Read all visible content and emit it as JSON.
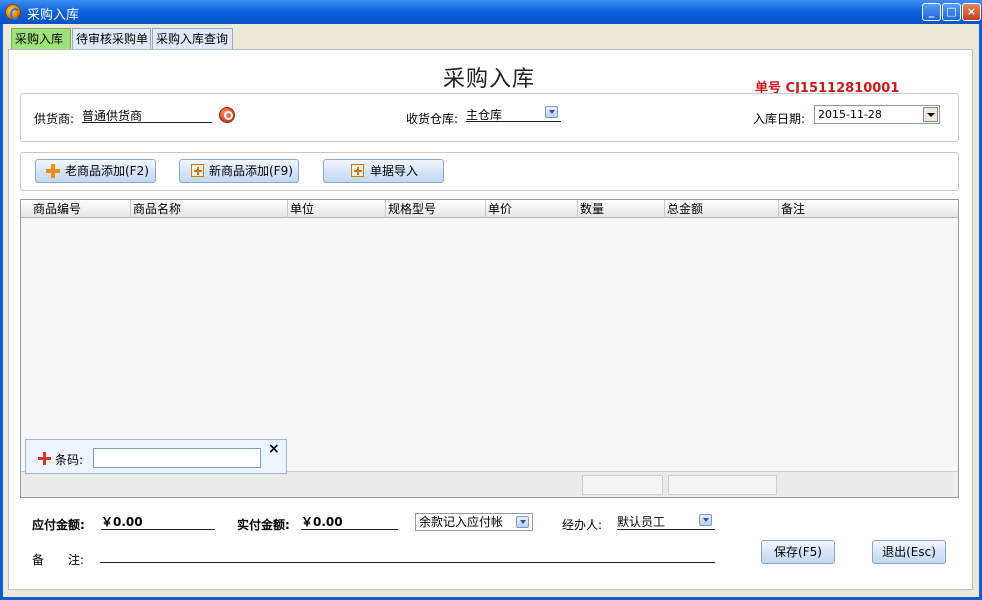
{
  "window": {
    "title": "采购入库",
    "min_label": "_",
    "max_label": "□",
    "close_label": "×"
  },
  "tabs": [
    {
      "label": "采购入库",
      "active": true
    },
    {
      "label": "待审核采购单",
      "active": false
    },
    {
      "label": "采购入库查询",
      "active": false
    }
  ],
  "header": {
    "title": "采购入库",
    "order_no": "单号 CJ15112810001"
  },
  "info": {
    "supplier_label": "供货商:",
    "supplier_value": "普通供货商",
    "warehouse_label": "收货仓库:",
    "warehouse_value": "主仓库",
    "date_label": "入库日期:",
    "date_value": "2015-11-28"
  },
  "toolbar": {
    "add_old": "老商品添加(F2)",
    "add_new": "新商品添加(F9)",
    "import": "单据导入"
  },
  "grid": {
    "columns": [
      "商品编号",
      "商品名称",
      "单位",
      "规格型号",
      "单价",
      "数量",
      "总金额",
      "备注"
    ]
  },
  "barcode": {
    "label": "条码:",
    "value": "",
    "close": "×"
  },
  "footer": {
    "payable_label": "应付金额:",
    "payable_value": "￥0.00",
    "paid_label": "实付金额:",
    "paid_value": "￥0.00",
    "balance_option": "余款记入应付帐",
    "handler_label": "经办人:",
    "handler_value": "默认员工",
    "remark_label": "备　　注:",
    "remark_value": "",
    "save": "保存(F5)",
    "exit": "退出(Esc)"
  },
  "colors": {
    "title_bar": "#0a5fd8",
    "active_tab": "#9fe27a",
    "order_no": "#d01818"
  }
}
